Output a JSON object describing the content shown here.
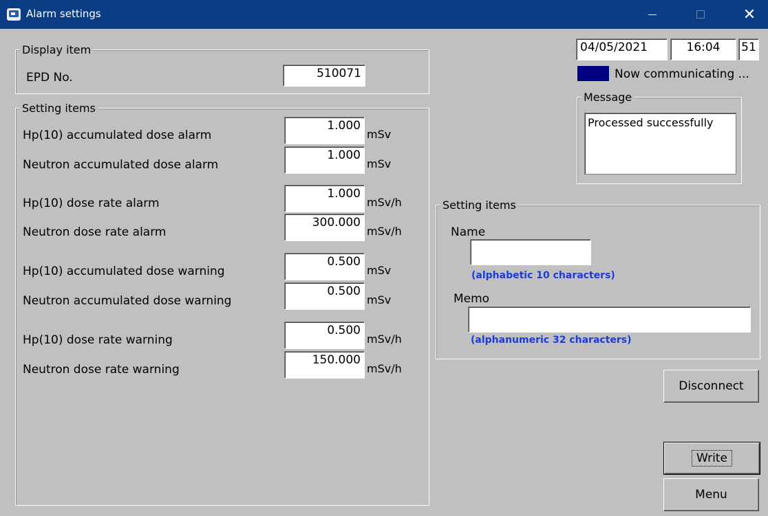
{
  "window": {
    "title": "Alarm settings",
    "close_glyph": "✕"
  },
  "display_item": {
    "legend": "Display item",
    "epd_label": "EPD No.",
    "epd_value": "510071"
  },
  "settings": {
    "legend": "Setting items",
    "rows": [
      {
        "label": "Hp(10) accumulated dose alarm",
        "value": "1.000",
        "unit": "mSv"
      },
      {
        "label": "Neutron accumulated dose alarm",
        "value": "1.000",
        "unit": "mSv"
      },
      {
        "label": "Hp(10) dose rate alarm",
        "value": "1.000",
        "unit": "mSv/h"
      },
      {
        "label": "Neutron dose rate alarm",
        "value": "300.000",
        "unit": "mSv/h"
      },
      {
        "label": "Hp(10) accumulated dose warning",
        "value": "0.500",
        "unit": "mSv"
      },
      {
        "label": "Neutron accumulated dose warning",
        "value": "0.500",
        "unit": "mSv"
      },
      {
        "label": "Hp(10) dose rate warning",
        "value": "0.500",
        "unit": "mSv/h"
      },
      {
        "label": "Neutron dose rate warning",
        "value": "150.000",
        "unit": "mSv/h"
      }
    ]
  },
  "header_status": {
    "date": "04/05/2021",
    "time": "16:04",
    "seconds": "51",
    "comm_text": "Now communicating ...",
    "comm_color": "#000080"
  },
  "message": {
    "legend": "Message",
    "text": "Processed successfully"
  },
  "right_settings": {
    "legend": "Setting items",
    "name_label": "Name",
    "name_value": "",
    "name_hint": "(alphabetic 10 characters)",
    "memo_label": "Memo",
    "memo_value": "",
    "memo_hint": "(alphanumeric 32 characters)"
  },
  "buttons": {
    "disconnect": "Disconnect",
    "write": "Write",
    "menu": "Menu"
  },
  "colors": {
    "titlebar": "#0a3d84",
    "background": "#c0c0c0",
    "hint": "#1f3adc"
  }
}
